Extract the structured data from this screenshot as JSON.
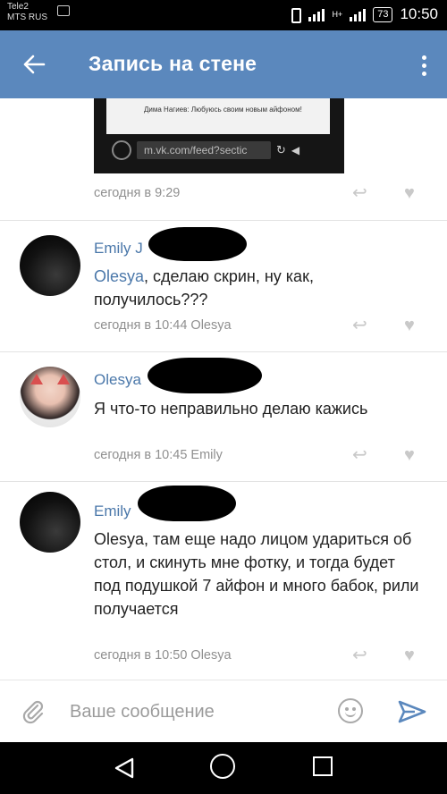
{
  "status_bar": {
    "carrier_line1": "Tele2",
    "carrier_line2": "MTS RUS",
    "network": "H+",
    "battery": "73",
    "time": "10:50"
  },
  "header": {
    "title": "Запись на стене",
    "back_icon": "arrow-left-icon",
    "menu_icon": "vertical-dots-icon"
  },
  "post_image": {
    "caption": "Дима Нагиев: Любуюсь своим новым айфоном!",
    "url": "m.vk.com/feed?sectic"
  },
  "post_meta": {
    "timestamp": "сегодня в 9:29"
  },
  "comments": [
    {
      "author": "Emily J",
      "mention": "Olesya",
      "text": ", сделаю скрин, ну как, получилось???",
      "timestamp": "сегодня в 10:44 Olesya"
    },
    {
      "author": "Olesya",
      "mention": "",
      "text": "Я что-то неправильно делаю кажись",
      "timestamp": "сегодня в 10:45 Emily"
    },
    {
      "author": "Emily",
      "mention": "",
      "text": "Olesya, там еще надо лицом удариться об стол, и скинуть мне фотку, и тогда будет под подушкой 7 айфон и много бабок, рили получается",
      "timestamp": "сегодня в 10:50 Olesya"
    }
  ],
  "input_bar": {
    "placeholder": "Ваше сообщение"
  },
  "colors": {
    "header_bg": "#5b88bd",
    "link": "#4b78aa",
    "meta_text": "#8f8f8f"
  }
}
